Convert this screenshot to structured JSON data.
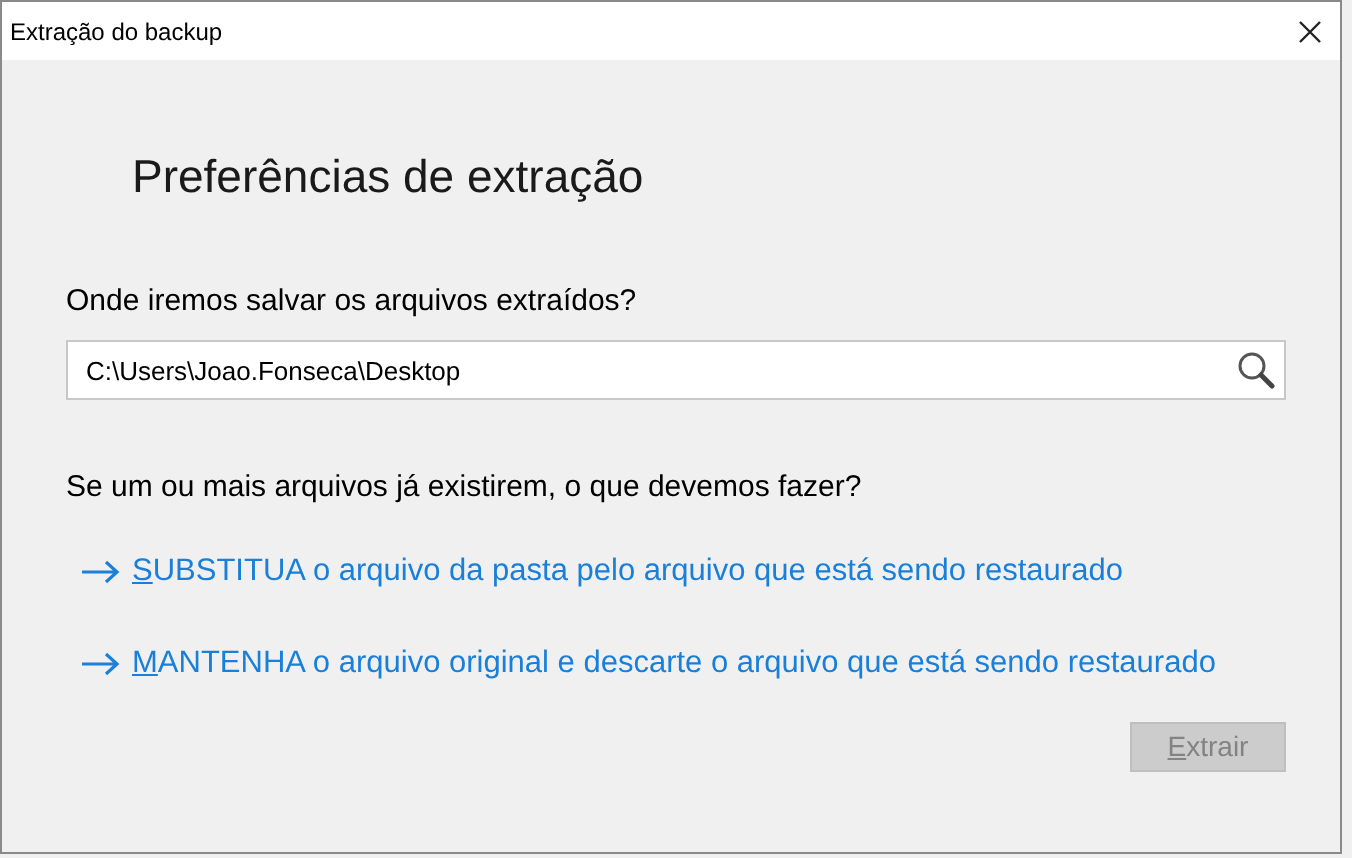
{
  "window": {
    "title": "Extração do backup"
  },
  "heading": "Preferências de extração",
  "location": {
    "label": "Onde iremos salvar os arquivos extraídos?",
    "value": "C:\\Users\\Joao.Fonseca\\Desktop"
  },
  "conflict": {
    "question": "Se um ou mais arquivos já existirem, o que devemos fazer?",
    "options": [
      {
        "label": "SUBSTITUA o arquivo da pasta pelo arquivo que está sendo restaurado"
      },
      {
        "label": "MANTENHA o arquivo original e descarte o arquivo que está sendo restaurado"
      }
    ]
  },
  "buttons": [
    {
      "label": "Extrair",
      "disabled": true
    }
  ]
}
